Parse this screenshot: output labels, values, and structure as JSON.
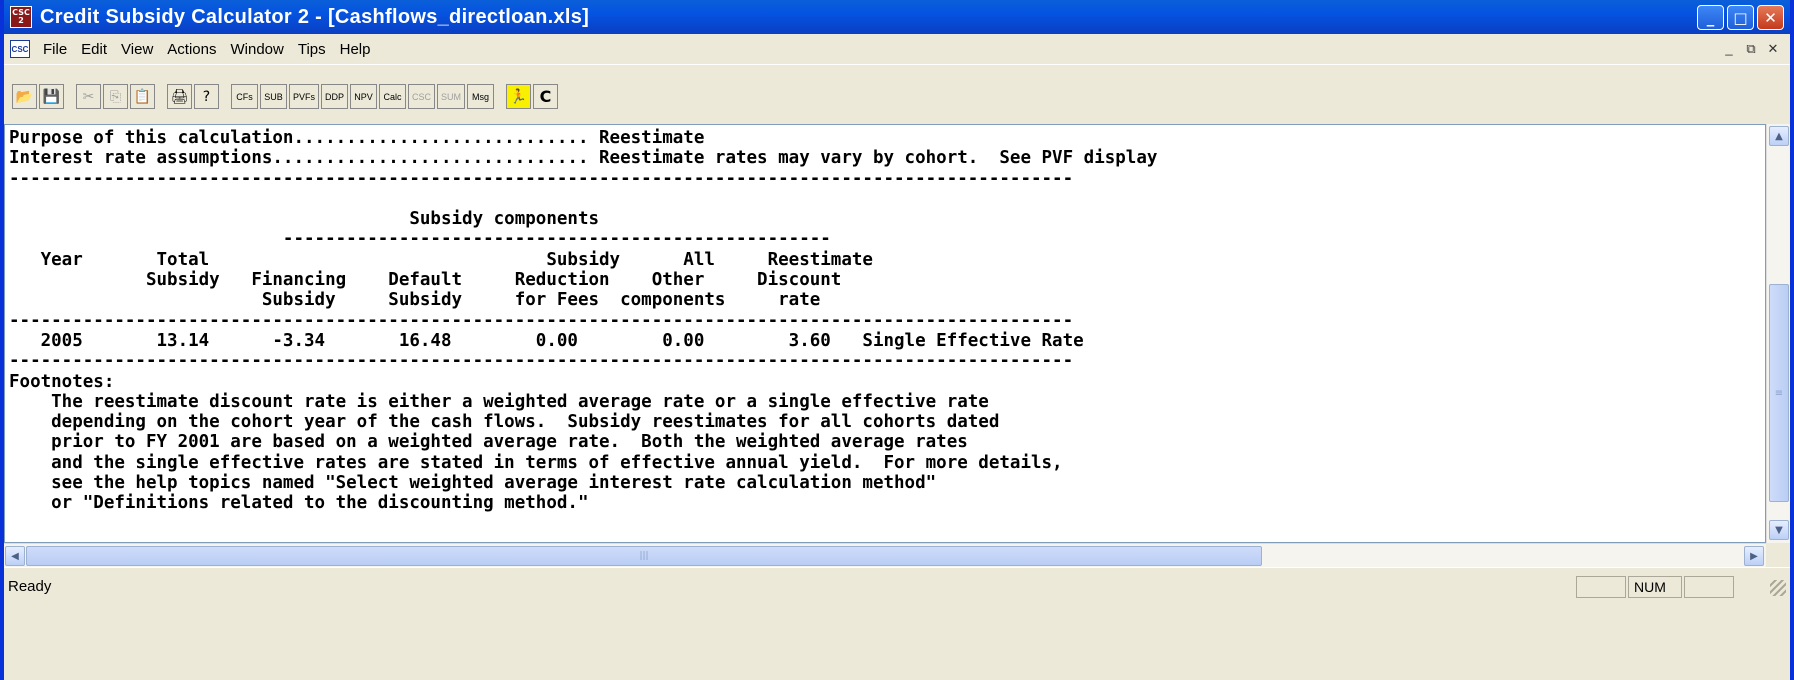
{
  "window": {
    "title": "Credit Subsidy Calculator 2 - [Cashflows_directloan.xls]",
    "app_icon_text": "CSC 2",
    "doc_icon_text": "CSC",
    "title_buttons": {
      "minimize": "_",
      "maximize": "□",
      "close": "✕"
    },
    "mdi_buttons": {
      "minimize": "_",
      "restore": "⧉",
      "close": "✕"
    }
  },
  "menu": [
    "File",
    "Edit",
    "View",
    "Actions",
    "Window",
    "Tips",
    "Help"
  ],
  "toolbar": {
    "open": "📂",
    "save": "💾",
    "cut": "✂",
    "copy": "⎘",
    "paste": "📋",
    "print": "🖨",
    "help": "?",
    "cfs": "CFs",
    "sub": "SUB",
    "pvfs": "PVFs",
    "ddp": "DDP",
    "npv": "NPV",
    "calc": "Calc",
    "csc": "CSC",
    "sum": "SUM",
    "msg": "Msg",
    "run": "🏃",
    "refresh": "C"
  },
  "report": {
    "line1": "Purpose of this calculation............................ Reestimate",
    "line2": "Interest rate assumptions.............................. Reestimate rates may vary by cohort.  See PVF display",
    "sep": "-----------------------------------------------------------------------------------------------------",
    "blank": "",
    "components_title": "                                      Subsidy components",
    "components_sep": "                          ----------------------------------------------------",
    "head1": "   Year       Total                                Subsidy      All     Reestimate",
    "head2": "             Subsidy   Financing    Default     Reduction    Other     Discount",
    "head3": "                        Subsidy     Subsidy     for Fees  components     rate",
    "row1": "   2005       13.14      -3.34       16.48        0.00        0.00        3.60   Single Effective Rate",
    "fn_title": "Footnotes:",
    "fn1": "    The reestimate discount rate is either a weighted average rate or a single effective rate",
    "fn2": "    depending on the cohort year of the cash flows.  Subsidy reestimates for all cohorts dated",
    "fn3": "    prior to FY 2001 are based on a weighted average rate.  Both the weighted average rates",
    "fn4": "    and the single effective rates are stated in terms of effective annual yield.  For more details,",
    "fn5": "    see the help topics named \"Select weighted average interest rate calculation method\"",
    "fn6": "    or \"Definitions related to the discounting method.\""
  },
  "scrollbars": {
    "up": "▲",
    "down": "▼",
    "left": "◀",
    "right": "▶",
    "grip_v": "≡",
    "grip_h": "|||"
  },
  "status": {
    "text": "Ready",
    "num": "NUM"
  }
}
